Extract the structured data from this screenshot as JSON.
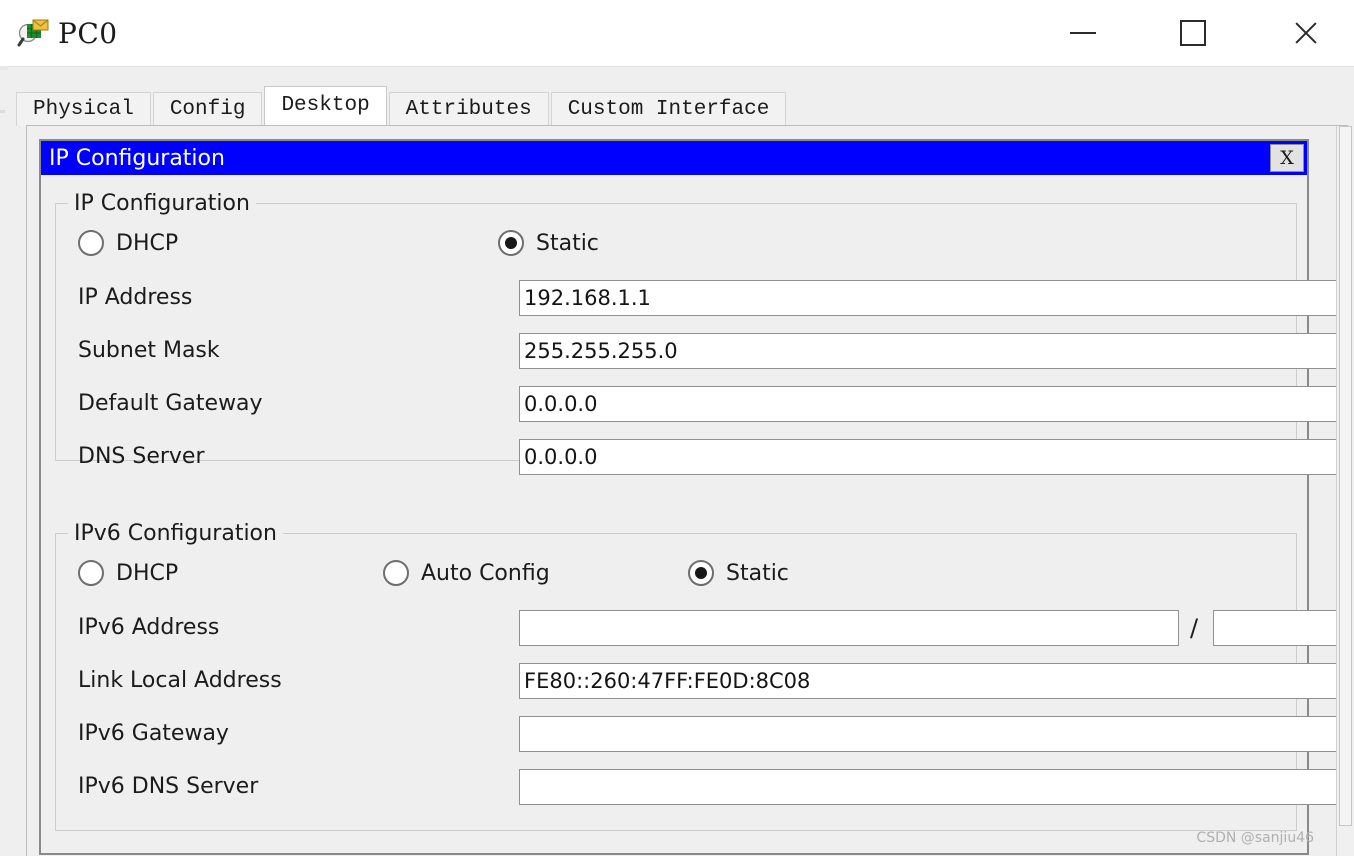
{
  "window": {
    "title": "PC0",
    "icon": "packet-tracer-pc-icon",
    "minimize_label": "—",
    "maximize_label": "□",
    "close_label": "✕"
  },
  "tabs": [
    {
      "label": "Physical",
      "active": false
    },
    {
      "label": "Config",
      "active": false
    },
    {
      "label": "Desktop",
      "active": true
    },
    {
      "label": "Attributes",
      "active": false
    },
    {
      "label": "Custom Interface",
      "active": false
    }
  ],
  "dialog": {
    "title": "IP Configuration",
    "close_label": "X",
    "titlebar_color": "#0000ff",
    "titlebar_text_color": "#ffffff"
  },
  "ipv4": {
    "legend": "IP Configuration",
    "modes": [
      {
        "label": "DHCP",
        "selected": false
      },
      {
        "label": "Static",
        "selected": true
      }
    ],
    "fields": [
      {
        "label": "IP Address",
        "value": "192.168.1.1"
      },
      {
        "label": "Subnet Mask",
        "value": "255.255.255.0"
      },
      {
        "label": "Default Gateway",
        "value": "0.0.0.0"
      },
      {
        "label": "DNS Server",
        "value": "0.0.0.0"
      }
    ]
  },
  "ipv6": {
    "legend": "IPv6 Configuration",
    "modes": [
      {
        "label": "DHCP",
        "selected": false
      },
      {
        "label": "Auto Config",
        "selected": false
      },
      {
        "label": "Static",
        "selected": true
      }
    ],
    "address": {
      "label": "IPv6 Address",
      "value": "",
      "separator": "/",
      "prefix_value": ""
    },
    "fields": [
      {
        "label": "Link Local Address",
        "value": "FE80::260:47FF:FE0D:8C08"
      },
      {
        "label": "IPv6 Gateway",
        "value": ""
      },
      {
        "label": "IPv6 DNS Server",
        "value": ""
      }
    ]
  },
  "watermark": "CSDN @sanjiu46"
}
